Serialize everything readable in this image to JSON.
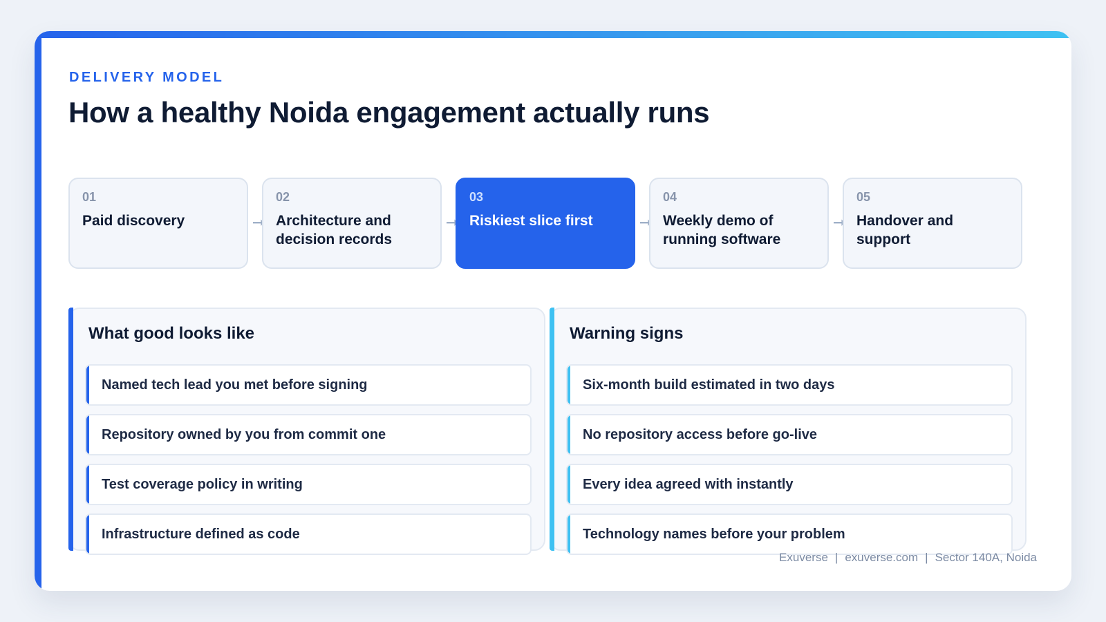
{
  "header": {
    "eyebrow": "DELIVERY MODEL",
    "title": "How a healthy Noida engagement actually runs"
  },
  "steps": [
    {
      "num": "01",
      "label": "Paid discovery",
      "active": false
    },
    {
      "num": "02",
      "label": "Architecture and decision records",
      "active": false
    },
    {
      "num": "03",
      "label": "Riskiest slice first",
      "active": true
    },
    {
      "num": "04",
      "label": "Weekly demo of running software",
      "active": false
    },
    {
      "num": "05",
      "label": "Handover and support",
      "active": false
    }
  ],
  "good_panel": {
    "title": "What good looks like",
    "accent_color": "#2563eb",
    "items": [
      "Named tech lead you met before signing",
      "Repository owned by you from commit one",
      "Test coverage policy in writing",
      "Infrastructure defined as code"
    ]
  },
  "warning_panel": {
    "title": "Warning signs",
    "accent_color": "#3ec1f2",
    "items": [
      "Six-month build estimated in two days",
      "No repository access before go-live",
      "Every idea agreed with instantly",
      "Technology names before your problem"
    ]
  },
  "footer": {
    "brand": "Exuverse",
    "site": "exuverse.com",
    "location": "Sector 140A, Noida",
    "separator": "|"
  },
  "colors": {
    "primary": "#2563eb",
    "cyan": "#3ec1f2",
    "text": "#0f1b33"
  }
}
